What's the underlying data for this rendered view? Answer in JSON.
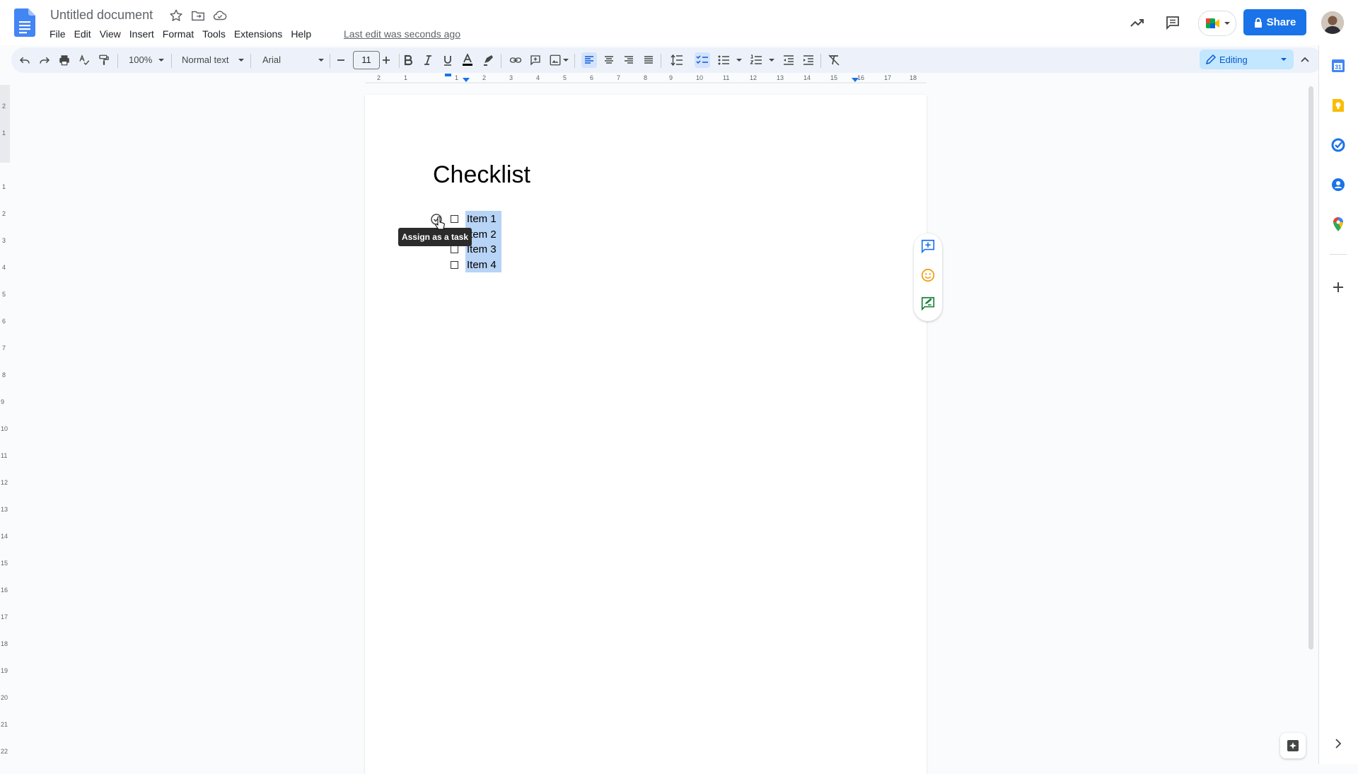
{
  "header": {
    "title": "Untitled document",
    "last_edit": "Last edit was seconds ago",
    "share_label": "Share",
    "menu": [
      "File",
      "Edit",
      "View",
      "Insert",
      "Format",
      "Tools",
      "Extensions",
      "Help"
    ]
  },
  "toolbar": {
    "zoom": "100%",
    "style": "Normal text",
    "font": "Arial",
    "font_size": "11",
    "mode": "Editing"
  },
  "rulers": {
    "horizontal": [
      "2",
      "1",
      "1",
      "2",
      "3",
      "4",
      "5",
      "6",
      "7",
      "8",
      "9",
      "10",
      "11",
      "12",
      "13",
      "14",
      "15",
      "16",
      "17",
      "18"
    ],
    "vertical": [
      "2",
      "1",
      "1",
      "2",
      "3",
      "4",
      "5",
      "6",
      "7",
      "8",
      "9",
      "10",
      "11",
      "12",
      "13",
      "14",
      "15",
      "16",
      "17",
      "18",
      "19",
      "20",
      "21",
      "22"
    ]
  },
  "document": {
    "heading": "Checklist",
    "items": [
      "Item 1",
      "Item 2",
      "Item 3",
      "Item 4"
    ],
    "tooltip": "Assign as a task"
  },
  "colors": {
    "share": "#1a73e8",
    "selection": "#b7d3f5",
    "toolbar_bg": "#edf2fa",
    "mode_bg": "#c2e7ff"
  },
  "icons": {
    "header": [
      "docs-logo-icon",
      "star-icon",
      "move-folder-icon",
      "cloud-saved-icon",
      "trending-icon",
      "comments-icon",
      "meet-icon",
      "lock-icon"
    ],
    "side_panel": [
      "calendar-icon",
      "keep-icon",
      "tasks-icon",
      "contacts-icon",
      "maps-icon",
      "plus-icon",
      "chevron-right-icon"
    ]
  }
}
